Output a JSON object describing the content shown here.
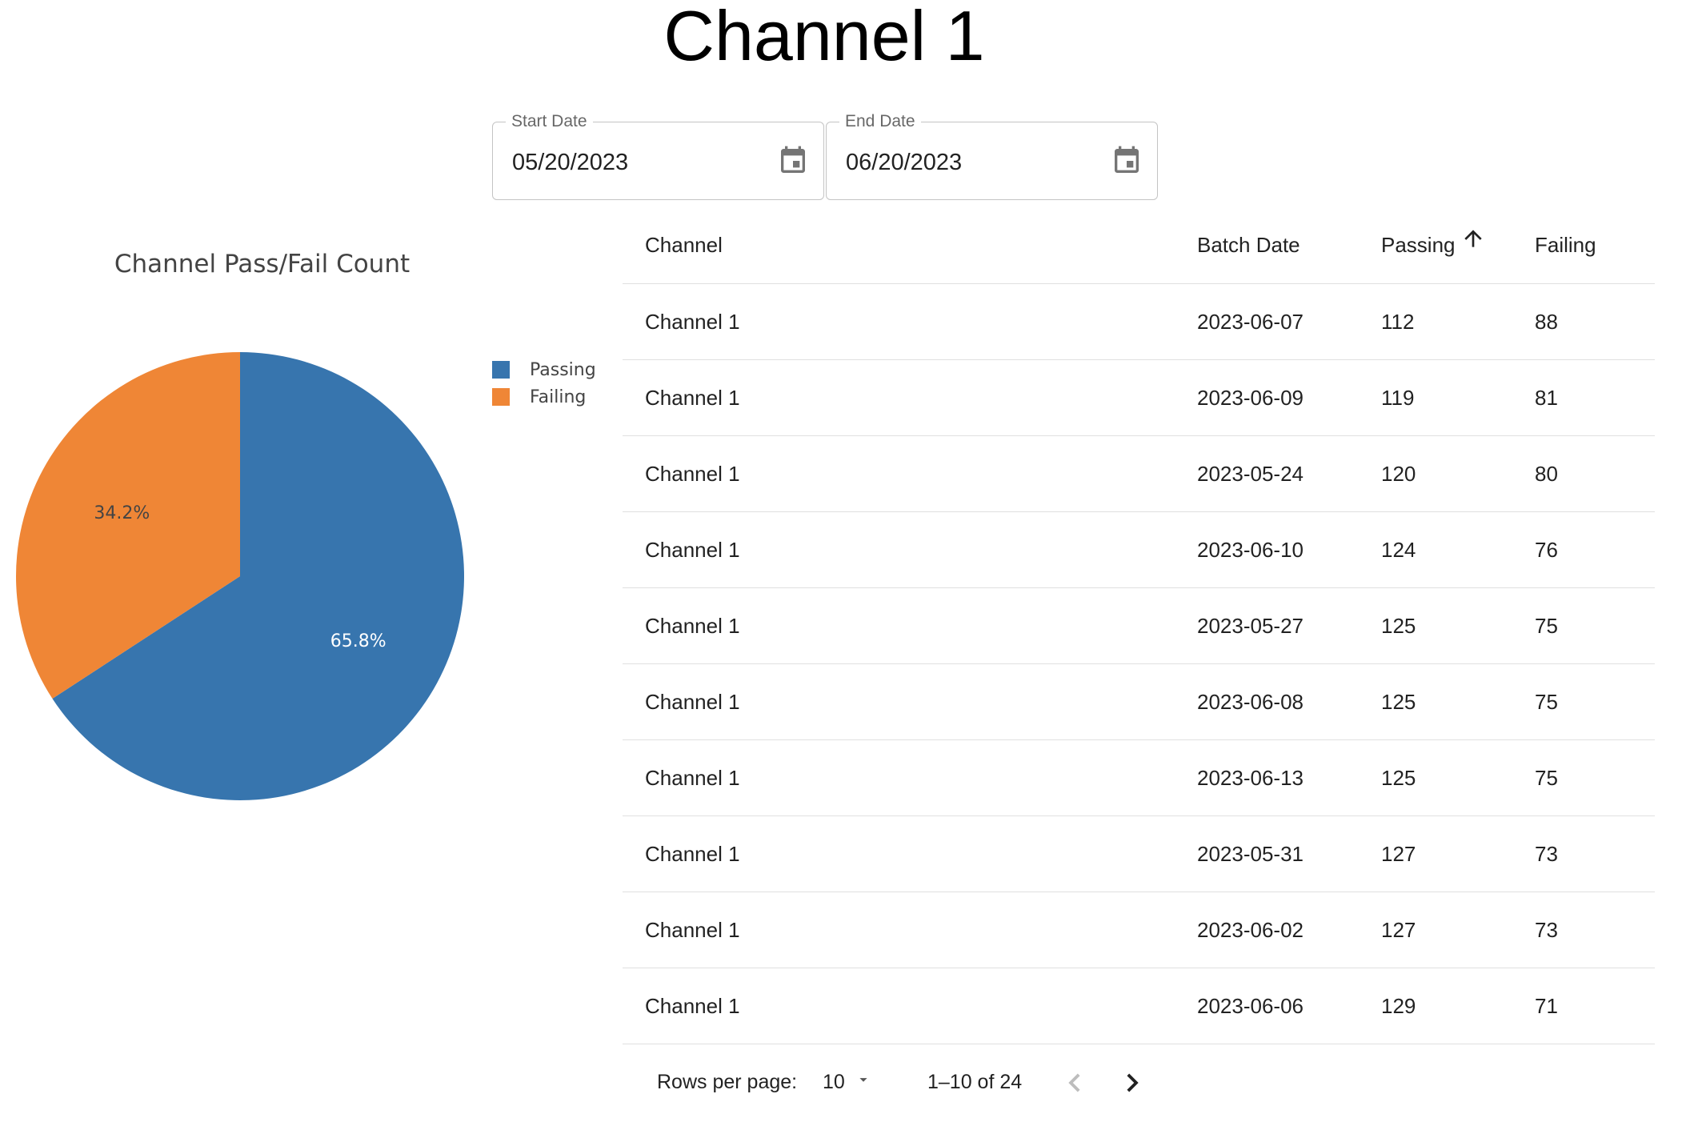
{
  "page": {
    "title": "Channel 1"
  },
  "filters": {
    "start": {
      "label": "Start Date",
      "value": "05/20/2023",
      "icon": "calendar-icon"
    },
    "end": {
      "label": "End Date",
      "value": "06/20/2023",
      "icon": "calendar-icon"
    }
  },
  "chart_data": {
    "type": "pie",
    "title": "Channel Pass/Fail Count",
    "labels": [
      "Passing",
      "Failing"
    ],
    "values": [
      65.8,
      34.2
    ],
    "value_labels": [
      "65.8%",
      "34.2%"
    ],
    "colors": [
      "#3775ae",
      "#ef8636"
    ],
    "legend": "top-right"
  },
  "table": {
    "headers": [
      "Channel",
      "Batch Date",
      "Passing",
      "Failing"
    ],
    "sort": {
      "column": "Passing",
      "direction": "ascending",
      "icon": "arrow-up-icon"
    },
    "rows": [
      [
        "Channel 1",
        "2023-06-07",
        "112",
        "88"
      ],
      [
        "Channel 1",
        "2023-06-09",
        "119",
        "81"
      ],
      [
        "Channel 1",
        "2023-05-24",
        "120",
        "80"
      ],
      [
        "Channel 1",
        "2023-06-10",
        "124",
        "76"
      ],
      [
        "Channel 1",
        "2023-05-27",
        "125",
        "75"
      ],
      [
        "Channel 1",
        "2023-06-08",
        "125",
        "75"
      ],
      [
        "Channel 1",
        "2023-06-13",
        "125",
        "75"
      ],
      [
        "Channel 1",
        "2023-05-31",
        "127",
        "73"
      ],
      [
        "Channel 1",
        "2023-06-02",
        "127",
        "73"
      ],
      [
        "Channel 1",
        "2023-06-06",
        "129",
        "71"
      ]
    ]
  },
  "pagination": {
    "rows_per_page_label": "Rows per page:",
    "rows_per_page": "10",
    "range": "1–10 of 24",
    "prev_enabled": false,
    "next_enabled": true
  }
}
